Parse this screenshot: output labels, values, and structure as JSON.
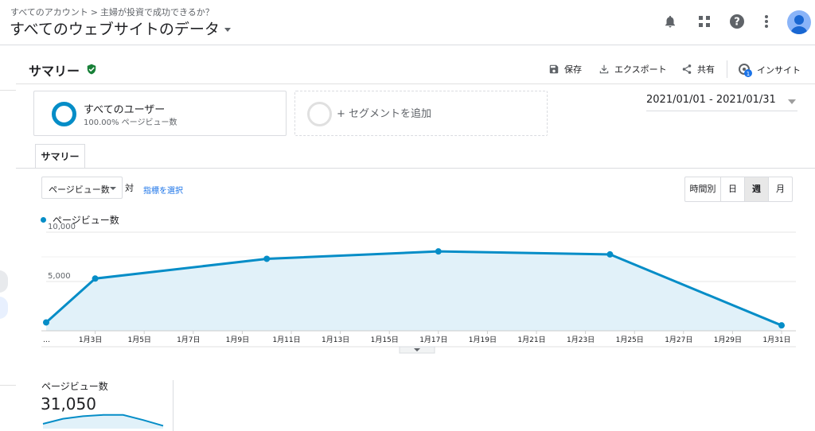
{
  "header": {
    "breadcrumb": [
      "すべてのアカウント",
      "主婦が投資で成功できるか？"
    ],
    "breadcrumb_sep": ">",
    "property": "すべてのウェブサイトのデータ",
    "icons": [
      "bell-icon",
      "apps-grid-icon",
      "help-icon",
      "more-vert-icon",
      "account-avatar"
    ]
  },
  "report": {
    "title": "サマリー",
    "actions": {
      "save": "保存",
      "export": "エクスポート",
      "share": "共有",
      "insight": "インサイト",
      "insight_badge": "1"
    },
    "segments": [
      {
        "name": "すべてのユーザー",
        "sub": "100.00% ページビュー数"
      },
      {
        "name": "+ セグメントを追加"
      }
    ],
    "date_range": "2021/01/01 - 2021/01/31",
    "tab": "サマリー",
    "metric_select": "ページビュー数",
    "vs": "対",
    "pick_metric": "指標を選択",
    "granularity": [
      {
        "label": "時間別",
        "active": false
      },
      {
        "label": "日",
        "active": false
      },
      {
        "label": "週",
        "active": true
      },
      {
        "label": "月",
        "active": false
      }
    ],
    "summary": {
      "label": "ページビュー数",
      "value": "31,050"
    }
  },
  "colors": {
    "series": "#058dc7",
    "fill": "#e1f1f9",
    "accent": "#1a73e8",
    "verified": "#188038"
  },
  "chart_data": {
    "type": "area",
    "series": [
      {
        "name": "ページビュー数",
        "x": [
          "2021-01-01",
          "2021-01-03",
          "2021-01-10",
          "2021-01-17",
          "2021-01-24",
          "2021-01-31"
        ],
        "values": [
          850,
          5300,
          7300,
          8050,
          7750,
          550
        ]
      }
    ],
    "x_ticks": [
      "…",
      "1月3日",
      "1月5日",
      "1月7日",
      "1月9日",
      "1月11日",
      "1月13日",
      "1月15日",
      "1月17日",
      "1月19日",
      "1月21日",
      "1月23日",
      "1月25日",
      "1月27日",
      "1月29日",
      "1月31日"
    ],
    "y_ticks": [
      "5,000",
      "10,000"
    ],
    "ylim": [
      0,
      10000
    ],
    "grid": true
  },
  "sparkline": [
    0.25,
    0.65,
    0.85,
    0.95,
    0.95,
    0.55,
    0.1
  ]
}
